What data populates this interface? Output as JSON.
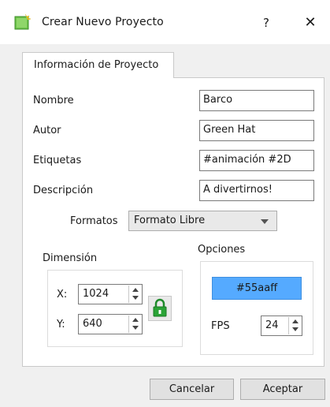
{
  "window": {
    "title": "Crear Nuevo Proyecto",
    "help_label": "?",
    "close_label": "✕"
  },
  "tab": {
    "label": "Información de Proyecto"
  },
  "form": {
    "nombre": {
      "label": "Nombre",
      "value": "Barco"
    },
    "autor": {
      "label": "Autor",
      "value": "Green Hat"
    },
    "etiquetas": {
      "label": "Etiquetas",
      "value": "#animación #2D"
    },
    "descripcion": {
      "label": "Descripción",
      "value": "A divertirnos!"
    },
    "formatos": {
      "label": "Formatos",
      "selected": "Formato Libre"
    }
  },
  "dimension": {
    "title": "Dimensión",
    "x_label": "X:",
    "x_value": "1024",
    "y_label": "Y:",
    "y_value": "640"
  },
  "opciones": {
    "title": "Opciones",
    "color_label": "#55aaff",
    "color": "#55aaff",
    "fps_label": "FPS",
    "fps_value": "24"
  },
  "buttons": {
    "cancel": "Cancelar",
    "accept": "Aceptar"
  }
}
